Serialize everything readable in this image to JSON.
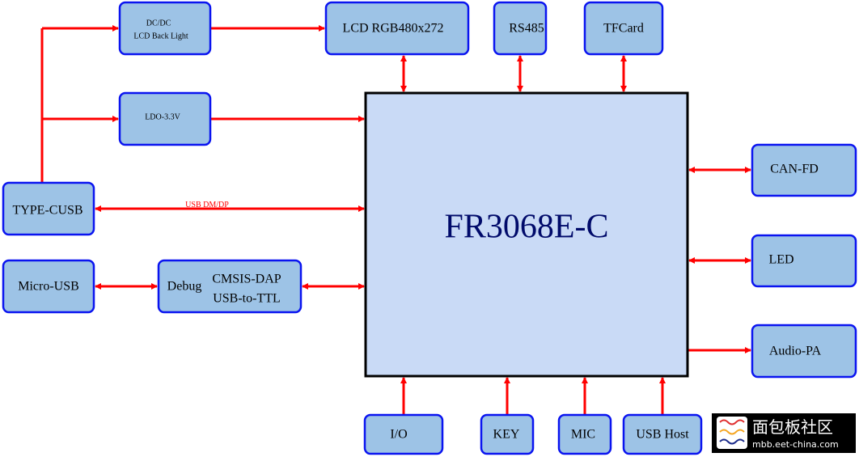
{
  "diagram": {
    "mcu": "FR3068E-C",
    "blocks": {
      "dcdc_line1": "DC/DC",
      "dcdc_line2": "LCD Back Light",
      "lcd": "LCD RGB480x272",
      "rs485": "RS485",
      "tfcard": "TFCard",
      "ldo": "LDO-3.3V",
      "typec": "TYPE-CUSB",
      "microusb": "Micro-USB",
      "debug_label": "Debug",
      "debug_line1": "CMSIS-DAP",
      "debug_line2": "USB-to-TTL",
      "canfd": "CAN-FD",
      "led": "LED",
      "audiopa": "Audio-PA",
      "io": "I/O",
      "key": "KEY",
      "mic": "MIC",
      "usbhost": "USB Host"
    },
    "edge_labels": {
      "usb": "USB DM/DP"
    },
    "colors": {
      "block_fill": "#9dc3e6",
      "block_border": "#0a14f0",
      "mcu_fill": "#c9daf6",
      "connector": "#ff0000"
    }
  },
  "watermark_logo": {
    "name": "面包板社区",
    "url": "mbb.eet-china.com"
  }
}
